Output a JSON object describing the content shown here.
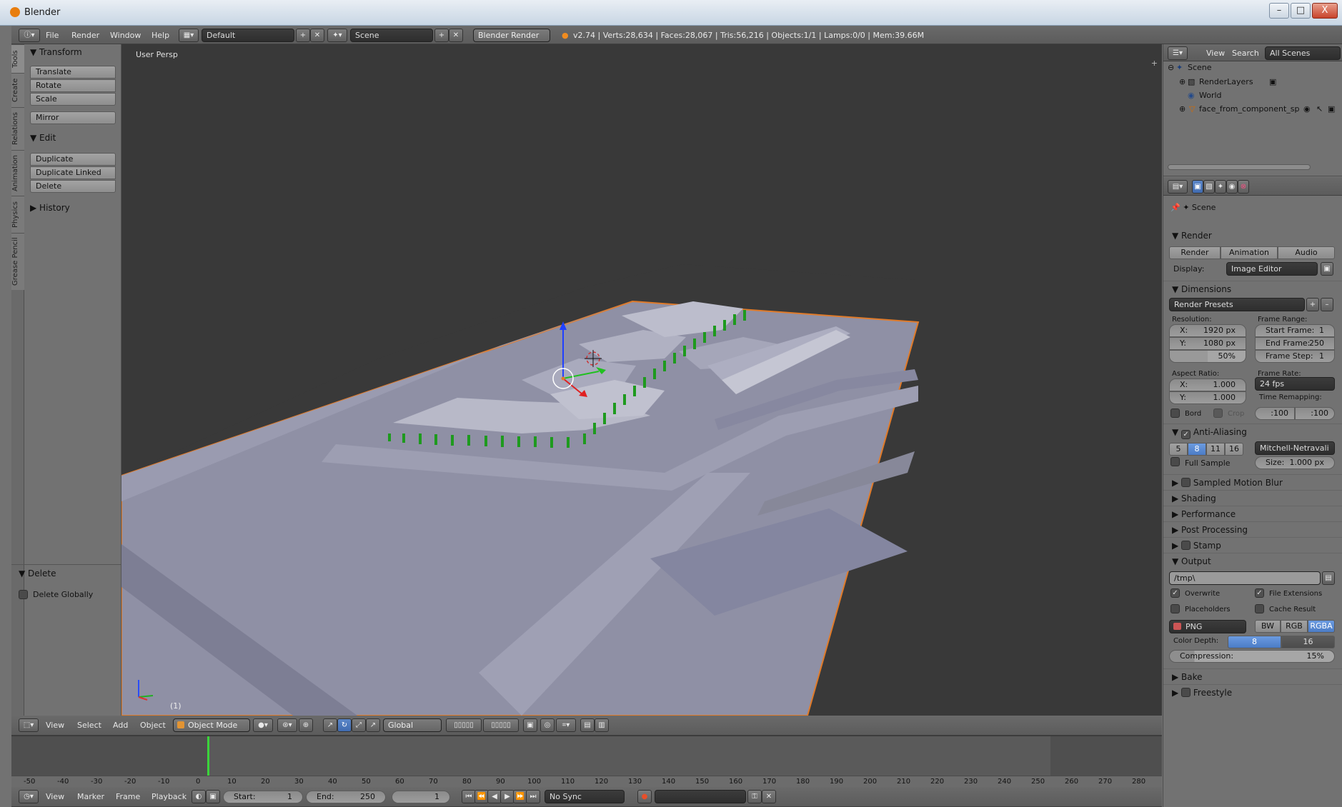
{
  "window": {
    "title": "Blender",
    "controls": {
      "minimize": "–",
      "maximize": "□",
      "close": "X"
    }
  },
  "menubar": {
    "menus": [
      "File",
      "Render",
      "Window",
      "Help"
    ],
    "screen_layout": "Default",
    "scene": "Scene",
    "engine": "Blender Render",
    "stats": "v2.74 | Verts:28,634 | Faces:28,067 | Tris:56,216 | Objects:1/1 | Lamps:0/0 | Mem:39.66M"
  },
  "left_tabs": [
    "Tools",
    "Create",
    "Relations",
    "Animation",
    "Physics",
    "Grease Pencil"
  ],
  "toolshelf": {
    "transform_title": "Transform",
    "transform_buttons": [
      "Translate",
      "Rotate",
      "Scale"
    ],
    "mirror": "Mirror",
    "edit_title": "Edit",
    "edit_buttons": [
      "Duplicate",
      "Duplicate Linked",
      "Delete"
    ],
    "history_title": "History",
    "operator_title": "Delete",
    "operator_option": "Delete Globally"
  },
  "viewport": {
    "label": "User Persp",
    "frame": "(1)"
  },
  "view3d_header": {
    "menus": [
      "View",
      "Select",
      "Add",
      "Object"
    ],
    "mode": "Object Mode",
    "orientation": "Global"
  },
  "timeline": {
    "ticks": [
      "-50",
      "-40",
      "-30",
      "-20",
      "-10",
      "0",
      "10",
      "20",
      "30",
      "40",
      "50",
      "60",
      "70",
      "80",
      "90",
      "100",
      "110",
      "120",
      "130",
      "140",
      "150",
      "160",
      "170",
      "180",
      "190",
      "200",
      "210",
      "220",
      "230",
      "240",
      "250",
      "260",
      "270",
      "280"
    ],
    "current_frame": 1
  },
  "timeline_header": {
    "menus": [
      "View",
      "Marker",
      "Frame",
      "Playback"
    ],
    "start_label": "Start:",
    "start_value": "1",
    "end_label": "End:",
    "end_value": "250",
    "current": "1",
    "sync": "No Sync"
  },
  "outliner": {
    "header": {
      "view": "View",
      "search": "Search",
      "filter": "All Scenes"
    },
    "items": [
      "Scene",
      "RenderLayers",
      "World",
      "face_from_component_spli"
    ]
  },
  "properties": {
    "context": "Scene",
    "render": {
      "title": "Render",
      "buttons": [
        "Render",
        "Animation",
        "Audio"
      ],
      "display_label": "Display:",
      "display_value": "Image Editor"
    },
    "dimensions": {
      "title": "Dimensions",
      "presets": "Render Presets",
      "resolution_label": "Resolution:",
      "res_x_label": "X:",
      "res_x": "1920 px",
      "res_y_label": "Y:",
      "res_y": "1080 px",
      "percent": "50%",
      "frame_range_label": "Frame Range:",
      "start_label": "Start Frame:",
      "start": "1",
      "end_label": "End Frame:",
      "end": "250",
      "step_label": "Frame Step:",
      "step": "1",
      "aspect_label": "Aspect Ratio:",
      "asp_x_label": "X:",
      "asp_x": "1.000",
      "asp_y_label": "Y:",
      "asp_y": "1.000",
      "frame_rate_label": "Frame Rate:",
      "fps": "24 fps",
      "time_remap_label": "Time Remapping:",
      "remap_old": ":100",
      "remap_new": ":100",
      "bord": "Bord",
      "crop": "Crop"
    },
    "aa": {
      "title": "Anti-Aliasing",
      "samples": [
        "5",
        "8",
        "11",
        "16"
      ],
      "active_sample": "8",
      "filter": "Mitchell-Netravali",
      "full_sample": "Full Sample",
      "size_label": "Size:",
      "size": "1.000 px"
    },
    "panels": [
      "Sampled Motion Blur",
      "Shading",
      "Performance",
      "Post Processing",
      "Stamp"
    ],
    "output": {
      "title": "Output",
      "path": "/tmp\\",
      "overwrite": "Overwrite",
      "file_ext": "File Extensions",
      "placeholders": "Placeholders",
      "cache": "Cache Result",
      "format": "PNG",
      "color_modes": [
        "BW",
        "RGB",
        "RGBA"
      ],
      "active_color_mode": "RGBA",
      "depth_label": "Color Depth:",
      "depths": [
        "8",
        "16"
      ],
      "active_depth": "8",
      "compression_label": "Compression:",
      "compression": "15%"
    },
    "bake": "Bake",
    "freestyle": "Freestyle"
  },
  "colors": {
    "selection_outline": "#e07b2a",
    "mesh": "#8e8fa6",
    "fence": "#1e9a1e",
    "active_blue": "#5a8ad2"
  }
}
